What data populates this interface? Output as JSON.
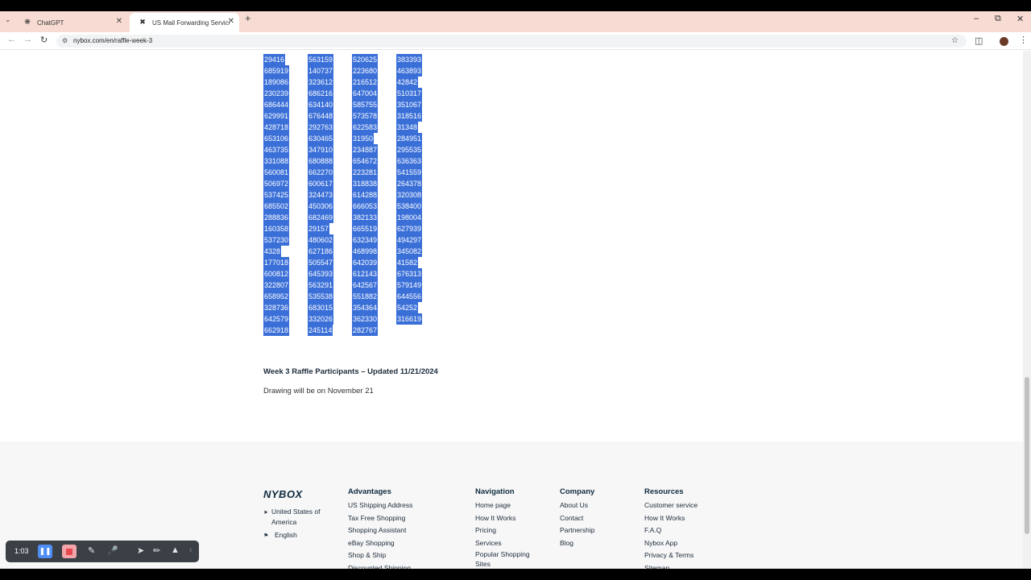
{
  "browser": {
    "tabs": [
      {
        "title": "ChatGPT",
        "favicon": "chatgpt-icon"
      },
      {
        "title": "US Mail Forwarding Service | Sh",
        "favicon": "nybox-x-icon",
        "active": true
      }
    ],
    "url": "nybox.com/en/raffle-week-3"
  },
  "raffle": {
    "columns": [
      [
        "29416",
        "685919",
        "189086",
        "230239",
        "686444",
        "629991",
        "428718",
        "653106",
        "463735",
        "331088",
        "560081",
        "506972",
        "537425",
        "685502",
        "288836",
        "160358",
        "537230",
        "4328",
        "177018",
        "600812",
        "322807",
        "658952",
        "328736",
        "642579",
        "662918"
      ],
      [
        "563159",
        "140737",
        "323612",
        "686216",
        "634140",
        "676448",
        "292763",
        "630465",
        "347910",
        "680888",
        "662270",
        "600617",
        "324473",
        "450306",
        "682469",
        "29157",
        "480602",
        "627186",
        "505547",
        "645393",
        "563291",
        "535538",
        "683015",
        "332026",
        "245114"
      ],
      [
        "520625",
        "223680",
        "216512",
        "647004",
        "585755",
        "573578",
        "622583",
        "31950",
        "234887",
        "654672",
        "223281",
        "318838",
        "614288",
        "666053",
        "382133",
        "665519",
        "632349",
        "468998",
        "642039",
        "612143",
        "642567",
        "551882",
        "354364",
        "362330",
        "282767"
      ],
      [
        "383393",
        "463893",
        "42842",
        "510317",
        "351067",
        "318516",
        "31348",
        "284951",
        "295535",
        "636363",
        "541559",
        "264378",
        "320308",
        "538400",
        "198004",
        "627939",
        "494297",
        "345082",
        "41582",
        "676313",
        "579149",
        "644556",
        "54252",
        "316619"
      ]
    ],
    "title": "Week 3 Raffle Participants – Updated 11/21/2024",
    "subtitle": "Drawing will be on November 21"
  },
  "footer": {
    "logo": "NYBOX",
    "location": "United States of America",
    "language": "English",
    "columns": [
      {
        "heading": "Advantages",
        "links": [
          "US Shipping Address",
          "Tax Free Shopping",
          "Shopping Assistant",
          "eBay Shopping",
          "Shop & Ship",
          "Discounted Shipping"
        ]
      },
      {
        "heading": "Navigation",
        "links": [
          "Home page",
          "How It Works",
          "Pricing",
          "Services",
          "Popular Shopping Sites"
        ]
      },
      {
        "heading": "Company",
        "links": [
          "About Us",
          "Contact",
          "Partnership",
          "Blog"
        ]
      },
      {
        "heading": "Resources",
        "links": [
          "Customer service",
          "How It Works",
          "F.A.Q",
          "Nybox App",
          "Privacy & Terms",
          "Sitemap"
        ]
      }
    ]
  },
  "recorder": {
    "time": "1:03"
  },
  "colors": {
    "selection": "#3a6fd8",
    "tabbar": "#f8dcd3",
    "stop": "#e8494f",
    "pause": "#4f8ef7"
  }
}
